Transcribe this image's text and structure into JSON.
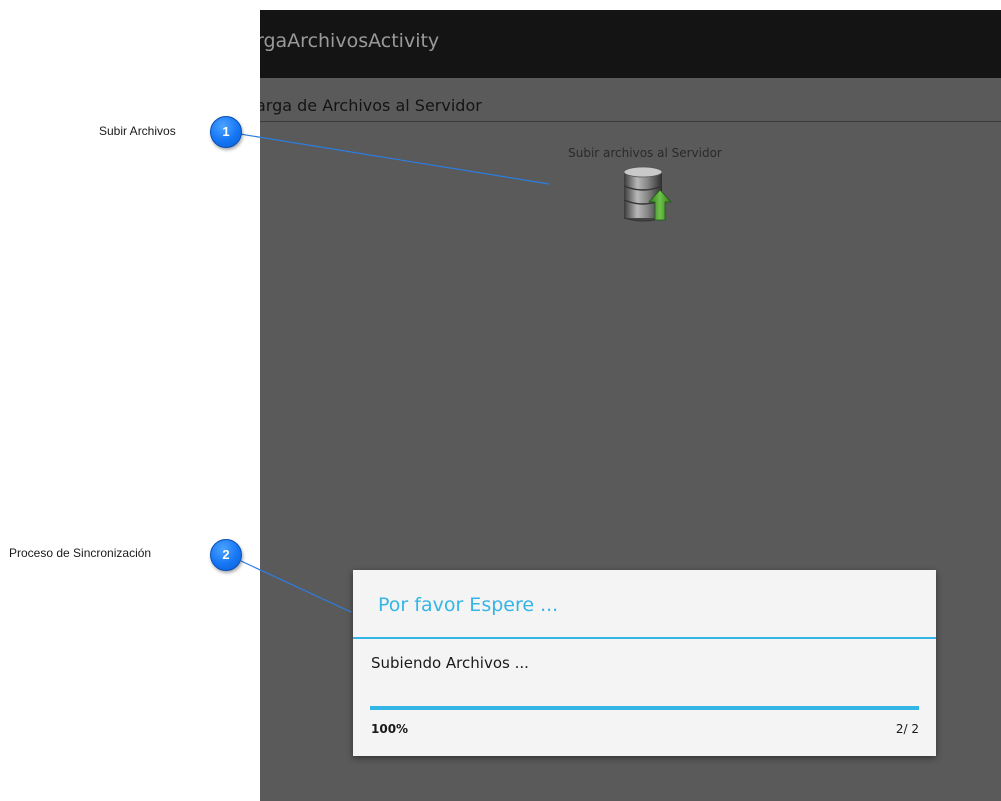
{
  "app_title": "rgaArchivosActivity",
  "section_header": "arga de Archivos al Servidor",
  "upload": {
    "label": "Subir archivos al Servidor",
    "icon": "database-upload-icon"
  },
  "dialog": {
    "title": "Por favor Espere ...",
    "message": "Subiendo Archivos ...",
    "progress_percent_label": "100%",
    "progress_count_label": "2/ 2",
    "progress_fraction": 1.0
  },
  "callouts": [
    {
      "number": "1",
      "label": "Subir Archivos"
    },
    {
      "number": "2",
      "label": "Proceso de Sincronización"
    }
  ],
  "colors": {
    "accent": "#33b5e5",
    "action_bar": "#141414",
    "overlay_background": "#5a5a5a",
    "badge_blue": "#1576f5"
  }
}
